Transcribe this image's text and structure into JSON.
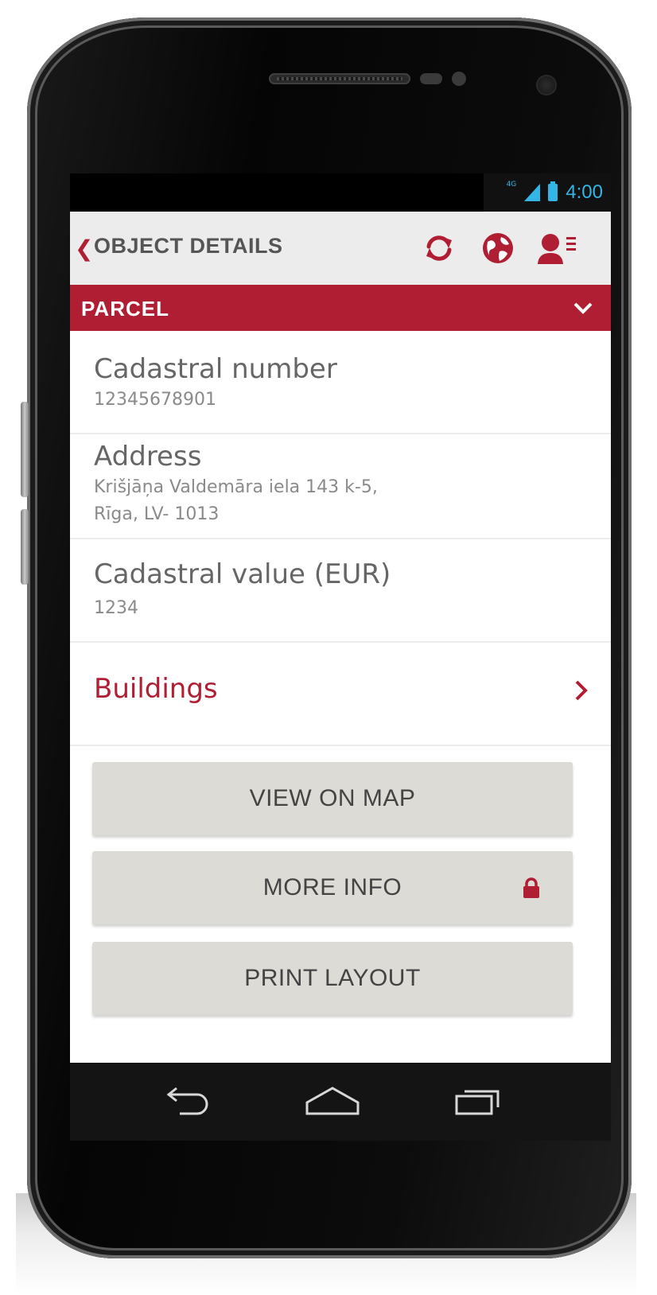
{
  "status_bar": {
    "network": "4G",
    "time": "4:00"
  },
  "app_bar": {
    "back_glyph": "❮",
    "title": "OBJECT DETAILS",
    "icons": [
      "refresh-icon",
      "globe-icon",
      "user-menu-icon"
    ]
  },
  "section": {
    "title": "PARCEL"
  },
  "fields": [
    {
      "label": "Cadastral number",
      "value": "12345678901"
    },
    {
      "label": "Address",
      "value_line1": "Krišjāņa Valdemāra iela 143 k-5,",
      "value_line2": "Rīga, LV- 1013"
    },
    {
      "label": "Cadastral value (EUR)",
      "value": "1234"
    }
  ],
  "buildings_link": {
    "label": "Buildings"
  },
  "buttons": {
    "view_on_map": "VIEW ON MAP",
    "more_info": "MORE INFO",
    "print_layout": "PRINT LAYOUT"
  },
  "colors": {
    "accent": "#b01e34",
    "button_bg": "#dddbd6",
    "status_blue": "#33b5e5"
  }
}
